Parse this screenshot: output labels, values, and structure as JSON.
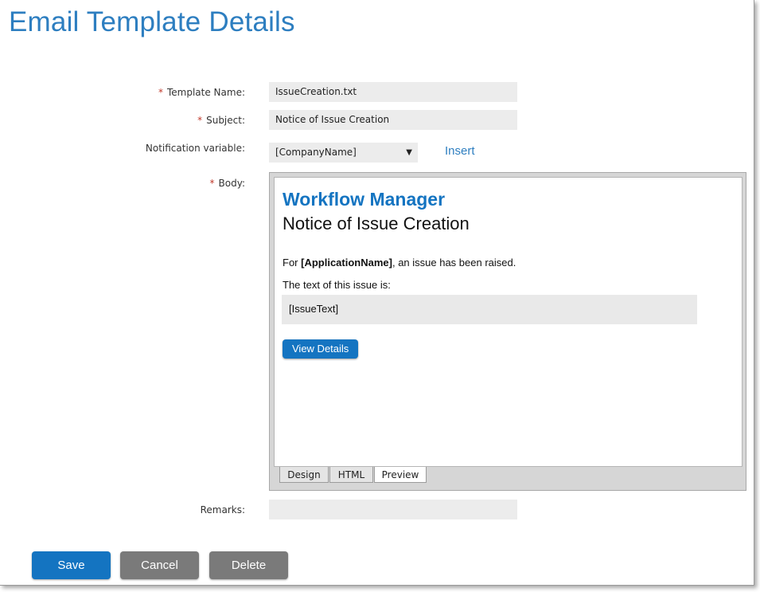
{
  "page": {
    "title": "Email Template Details"
  },
  "form": {
    "template_name": {
      "label": "Template Name:",
      "required_mark": "*",
      "value": "IssueCreation.txt"
    },
    "subject": {
      "label": "Subject:",
      "required_mark": "*",
      "value": "Notice of Issue Creation"
    },
    "notification_variable": {
      "label": "Notification variable:",
      "selected": "[CompanyName]",
      "insert_label": "Insert"
    },
    "body": {
      "label": "Body:",
      "required_mark": "*"
    },
    "remarks": {
      "label": "Remarks:",
      "value": ""
    }
  },
  "preview": {
    "brand": "Workflow Manager",
    "heading": "Notice of Issue Creation",
    "line1_prefix": "For ",
    "line1_bold": "[ApplicationName]",
    "line1_suffix": ", an issue has been raised.",
    "line2": "The text of this issue is:",
    "issue_text": "[IssueText]",
    "button_label": "View Details"
  },
  "editor_tabs": {
    "items": [
      {
        "label": "Design"
      },
      {
        "label": "HTML"
      },
      {
        "label": "Preview"
      }
    ],
    "active": "Preview"
  },
  "actions": {
    "save": "Save",
    "cancel": "Cancel",
    "delete": "Delete"
  },
  "colors": {
    "accent": "#2d7ec0",
    "primary_button": "#1474c1",
    "secondary_button": "#7a7a7a",
    "required_mark": "#c0392b"
  },
  "icons": {
    "dropdown": "caret-down-icon"
  }
}
